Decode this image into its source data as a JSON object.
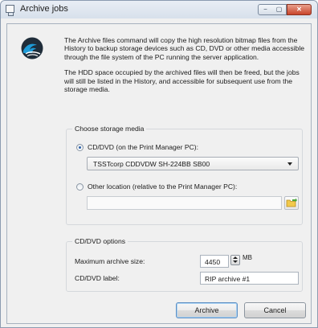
{
  "window": {
    "title": "Archive jobs",
    "controls": {
      "minimize": "−",
      "maximize": "▢",
      "close": "✕"
    }
  },
  "intro": {
    "paragraph1": "The Archive files command will copy the high resolution bitmap files from the History to backup storage devices such as CD, DVD or other media accessible through the file system of the PC running the server application.",
    "paragraph2": "The HDD space occupied by the archived files will then be freed, but the jobs will still be listed in the History, and accessible for subsequent use from the storage media."
  },
  "storage": {
    "caption": "Choose storage media",
    "cd_option_label": "CD/DVD (on the Print Manager PC):",
    "cd_selected": true,
    "drive_value": "TSSTcorp CDDVDW SH-224BB  SB00",
    "other_option_label": "Other location (relative to the Print Manager PC):",
    "other_selected": false,
    "other_path_value": ""
  },
  "options": {
    "caption": "CD/DVD options",
    "max_size_label": "Maximum archive size:",
    "max_size_value": "4450",
    "max_size_unit": "MB",
    "label_label": "CD/DVD label:",
    "label_value": "RIP archive #1"
  },
  "buttons": {
    "archive": "Archive",
    "cancel": "Cancel"
  },
  "colors": {
    "logo_blue": "#1e9bd7",
    "logo_dark": "#1f2d3a",
    "folder_green": "#4ca83a",
    "folder_yellow": "#f2c94c"
  },
  "icons": {
    "app": "window-icon",
    "logo": "wave-logo-icon",
    "folder": "folder-browse-icon"
  }
}
